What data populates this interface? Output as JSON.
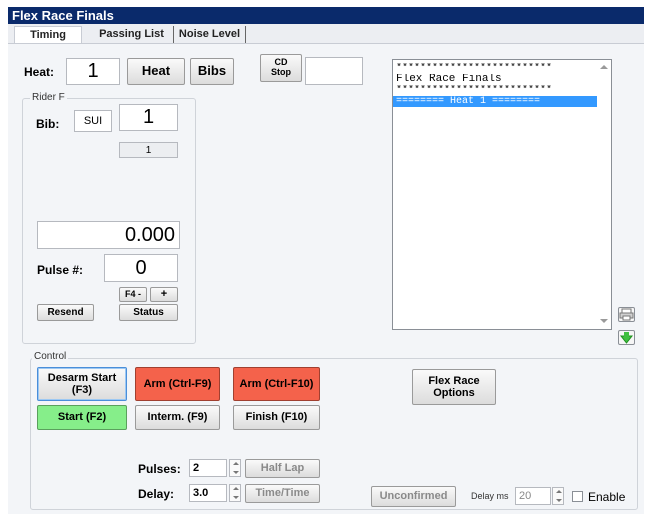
{
  "window": {
    "title": "Flex Race Finals"
  },
  "tabs": [
    {
      "label": "Timing"
    },
    {
      "label": "Passing List"
    },
    {
      "label": "Noise Level"
    }
  ],
  "heat": {
    "label": "Heat:",
    "value": "1",
    "heat_button": "Heat",
    "bibs_button": "Bibs",
    "cd_stop_button": "CD\nStop",
    "extra_value": ""
  },
  "rider": {
    "group_label": "Rider F",
    "bib_label": "Bib:",
    "bib_code": "SUI",
    "bib_number": "1",
    "bib_sub": "1",
    "time": "0.000",
    "pulse_label": "Pulse #:",
    "pulse_value": "0",
    "f4_minus": "F4 -",
    "plus": "+",
    "resend": "Resend",
    "status": "Status"
  },
  "log": {
    "lines": [
      "**************************",
      "Flex Race Finals",
      "**************************"
    ],
    "selected_line": "======== Heat 1 ========"
  },
  "side_icons": {
    "print": "printer-icon",
    "download": "down-arrow-icon"
  },
  "control": {
    "group_label": "Control",
    "desarm_start": "Desarm Start\n(F3)",
    "arm_f9": "Arm (Ctrl-F9)",
    "arm_f10": "Arm (Ctrl-F10)",
    "flex_race_options": "Flex Race\nOptions",
    "start": "Start (F2)",
    "interm": "Interm. (F9)",
    "finish": "Finish (F10)",
    "pulses_label": "Pulses:",
    "pulses_value": "2",
    "half_lap": "Half Lap",
    "delay_label": "Delay:",
    "delay_value": "3.0",
    "time_time": "Time/Time",
    "unconfirmed": "Unconfirmed",
    "delay_ms_label": "Delay ms",
    "delay_ms_value": "20",
    "enable_label": "Enable"
  },
  "colors": {
    "title_bar": "#0a2a6b",
    "arm_red": "#f4624b",
    "start_green": "#86ee8a",
    "selection": "#3399ff"
  }
}
